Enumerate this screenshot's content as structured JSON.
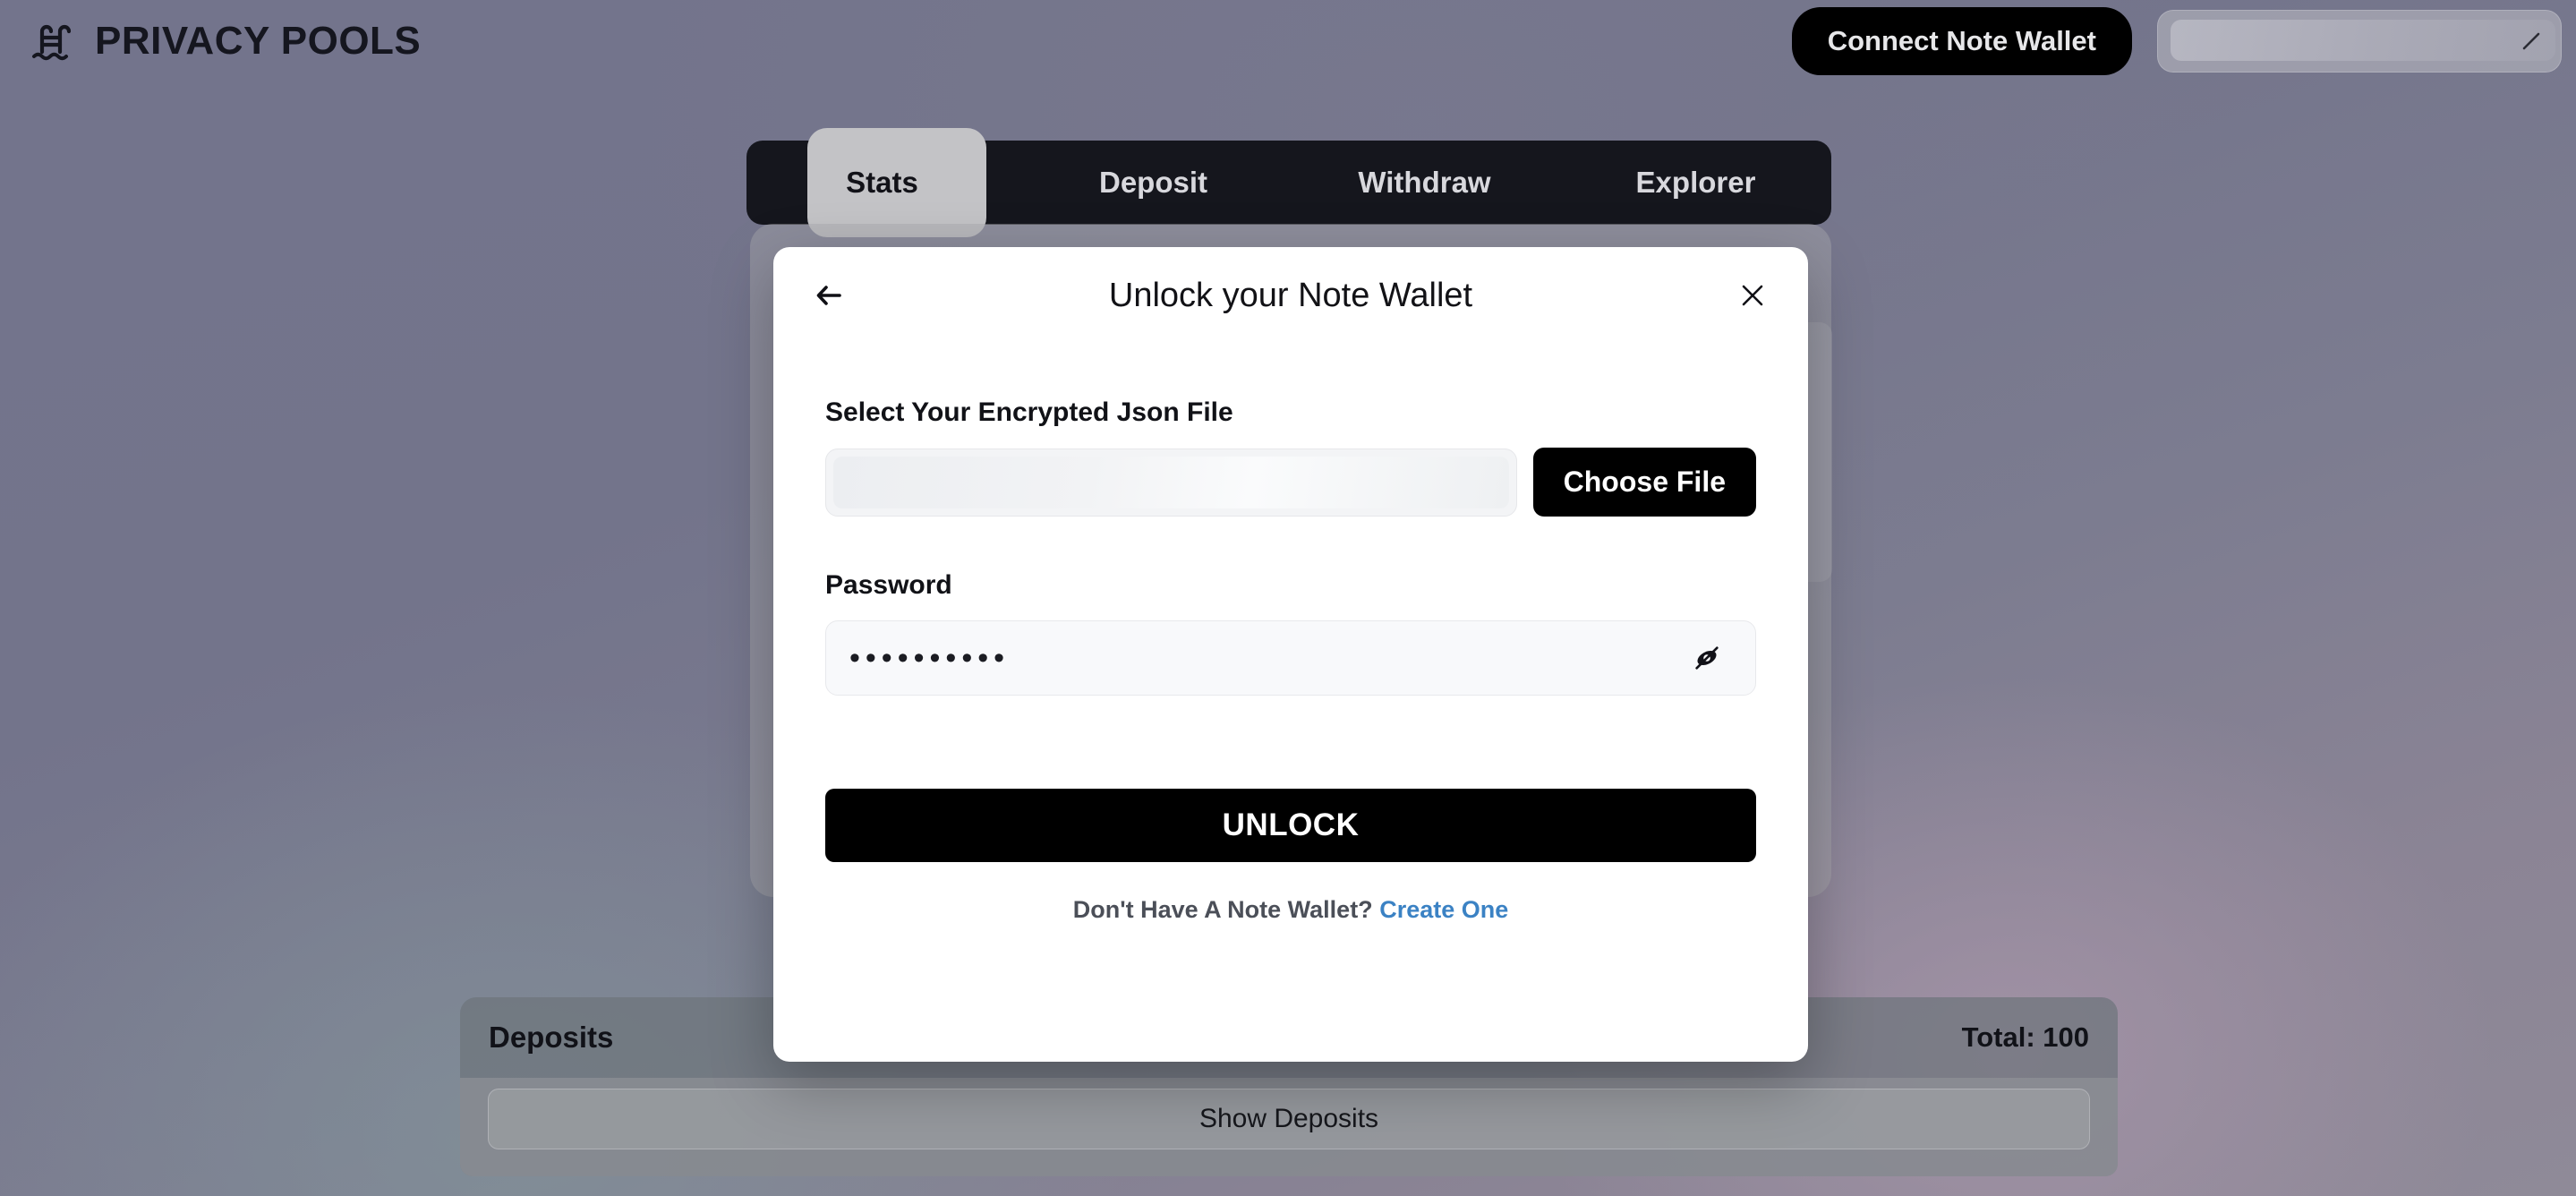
{
  "header": {
    "brand_title": "PRIVACY POOLS",
    "brand_icon": "pool-ladder-icon",
    "connect_button": "Connect Note Wallet",
    "wallet_pill_icon": "edit-pencil-icon"
  },
  "tabs": [
    {
      "label": "Stats",
      "active": true
    },
    {
      "label": "Deposit",
      "active": false
    },
    {
      "label": "Withdraw",
      "active": false
    },
    {
      "label": "Explorer",
      "active": false
    }
  ],
  "modal": {
    "title": "Unlock your Note Wallet",
    "back_icon": "arrow-left-icon",
    "close_icon": "close-x-icon",
    "file_field": {
      "label": "Select Your Encrypted Json File",
      "value": "",
      "placeholder": "",
      "button_label": "Choose File"
    },
    "password_field": {
      "label": "Password",
      "value": "••••••••••",
      "placeholder": "",
      "toggle_icon": "eye-off-icon"
    },
    "submit_label": "UNLOCK",
    "footer_text": "Don't Have A Note Wallet?",
    "footer_link": "Create One"
  },
  "deposits": {
    "title": "Deposits",
    "total": "Total: 100",
    "show_button": "Show Deposits"
  },
  "colors": {
    "accent_link": "#3b82c4",
    "button_primary": "#000000",
    "tab_bar": "#15161d",
    "tab_active": "#c3c3c6"
  }
}
